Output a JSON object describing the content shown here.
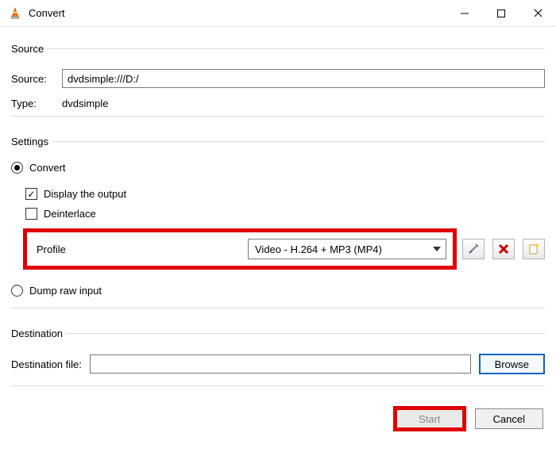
{
  "window": {
    "title": "Convert"
  },
  "source_group": {
    "legend": "Source",
    "source_label": "Source:",
    "source_value": "dvdsimple:///D:/",
    "type_label": "Type:",
    "type_value": "dvdsimple"
  },
  "settings_group": {
    "legend": "Settings",
    "convert_label": "Convert",
    "display_output_label": "Display the output",
    "deinterlace_label": "Deinterlace",
    "profile_label": "Profile",
    "profile_value": "Video - H.264 + MP3 (MP4)",
    "dump_label": "Dump raw input"
  },
  "destination_group": {
    "legend": "Destination",
    "dest_label": "Destination file:",
    "dest_value": "",
    "browse_label": "Browse"
  },
  "buttons": {
    "start": "Start",
    "cancel": "Cancel"
  }
}
